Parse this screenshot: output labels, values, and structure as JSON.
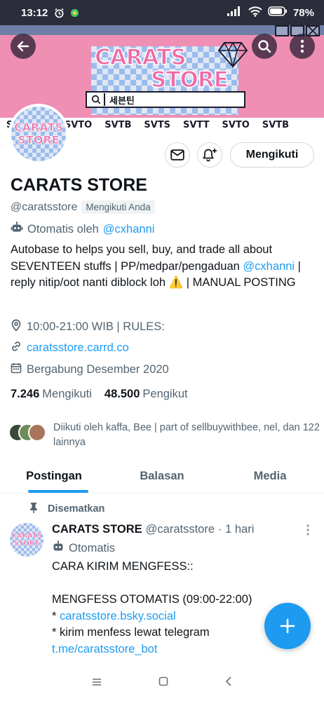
{
  "status_bar": {
    "time": "13:12",
    "battery": "78"
  },
  "banner": {
    "brand_line1": "CARATS",
    "brand_line2": "STORE",
    "search_text": "세븐틴",
    "ticker": [
      "S",
      "SVTT",
      "SVTO",
      "SVTB",
      "SVTS",
      "SVTT",
      "SVTO",
      "SVTB"
    ]
  },
  "avatar_text": [
    "CARATS",
    "STORE"
  ],
  "profile": {
    "name": "CARATS STORE",
    "handle": "@caratsstore",
    "follows_you": "Mengikuti Anda",
    "automated_prefix": "Otomatis oleh",
    "automated_by": "@cxhanni",
    "bio_part1": "Autobase to helps you sell, buy, and trade all about SEVENTEEN stuffs | PP/medpar/pengaduan",
    "bio_mention": "@cxhanni",
    "bio_part2": "| reply nitip/oot nanti diblock loh ⚠️ | MANUAL POSTING",
    "location": "10:00-21:00 WIB | RULES:",
    "website": "caratsstore.carrd.co",
    "joined": "Bergabung Desember 2020",
    "following_count": "7.246",
    "following_label": "Mengikuti",
    "followers_count": "48.500",
    "followers_label": "Pengikut",
    "followed_by": "Diikuti oleh kaffa, Bee | part of sellbuywithbee, nel, dan 122 lainnya",
    "follow_button": "Mengikuti"
  },
  "tabs": [
    "Postingan",
    "Balasan",
    "Media"
  ],
  "pinned_tweet": {
    "pinned_label": "Disematkan",
    "name": "CARATS STORE",
    "handle": "@caratsstore",
    "time": "· 1 hari",
    "automated": "Otomatis",
    "line1": "CARA KIRIM MENGFESS::",
    "line2": "MENGFESS OTOMATIS (09:00-22:00)",
    "line3_prefix": "*",
    "line3_link": "caratsstore.bsky.social",
    "line4_prefix": "* kirim menfess lewat telegram",
    "line4_link": "t.me/caratsstore_bot"
  },
  "colors": {
    "accent": "#1d9bf0",
    "banner_pink": "#ef8fb3",
    "brand_pink": "#ef6aa5"
  }
}
